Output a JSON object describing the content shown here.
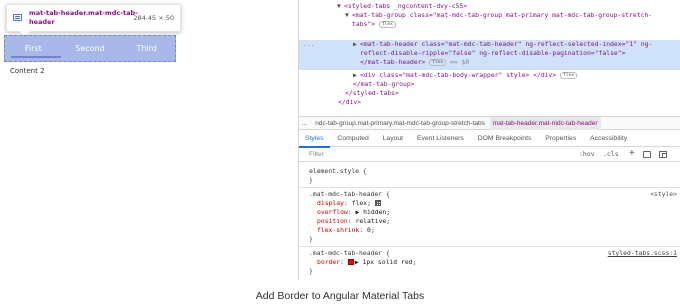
{
  "preview": {
    "tooltip_selector": "mat-tab-header.mat-mdc-tab-header",
    "tooltip_dims": "284.45 × 50",
    "tabs": [
      "First",
      "Second",
      "Third"
    ],
    "content_label": "Content 2"
  },
  "elements_tree": {
    "lines": [
      {
        "indent": 4,
        "text": "<styled-tabs _ngcontent-dvy-c55>"
      },
      {
        "indent": 5,
        "text": "<mat-tab-group class=\"mat-mdc-tab-group mat-primary mat-mdc-tab-group-stretch-"
      },
      {
        "indent": 5,
        "text": "tabs\">",
        "pill": "flex"
      },
      {
        "indent": 6,
        "text": "<mat-tab-header class=\"mat-mdc-tab-header\" ng-reflect-selected-index=\"1\" ng-"
      },
      {
        "indent": 6,
        "text": "reflect-disable-ripple=\"false\" ng-reflect-disable-pagination=\"false\">"
      },
      {
        "indent": 6,
        "text": "</mat-tab-header>",
        "pill": "flex",
        "suffix": "== $0"
      },
      {
        "indent": 6,
        "text": "<div class=\"mat-mdc-tab-body-wrapper\" style>",
        "suffix2": "</div>",
        "pill": "flex"
      },
      {
        "indent": 5,
        "text": "</mat-tab-group>"
      },
      {
        "indent": 4,
        "text": "</styled-tabs>"
      },
      {
        "indent": 3,
        "text": "</div>"
      }
    ],
    "dots": "..."
  },
  "breadcrumbs": [
    "...",
    "ndc-tab-group.mat-primary.mat-mdc-tab-group-stretch-tabs",
    "mat-tab-header.mat-mdc-tab-header"
  ],
  "panel_tabs": [
    "Styles",
    "Computed",
    "Layout",
    "Event Listeners",
    "DOM Breakpoints",
    "Properties",
    "Accessibility"
  ],
  "filter": {
    "placeholder": "Filter",
    "hov": ":hov",
    "cls": ".cls",
    "plus": "+"
  },
  "styles": {
    "element_style": "element.style {",
    "rule1_selector": ".mat-mdc-tab-header {",
    "rule1_source": "<style>",
    "rule1_props": [
      {
        "name": "display",
        "value": "flex;"
      },
      {
        "name": "overflow",
        "value": "▶ hidden;"
      },
      {
        "name": "position",
        "value": "relative;"
      },
      {
        "name": "flex-shrink",
        "value": "0;"
      }
    ],
    "rule2_selector": ".mat-mdc-tab-header {",
    "rule2_source": "styled-tabs.scss:1",
    "rule2_prop": {
      "name": "border",
      "value": "▶ 1px solid red;"
    },
    "close": "}"
  },
  "caption": "Add Border to Angular Material Tabs"
}
